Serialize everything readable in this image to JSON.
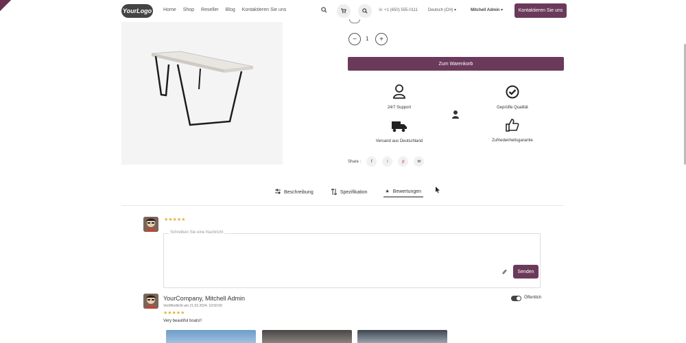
{
  "header": {
    "logo_text": "YourLogo",
    "nav": [
      "Home",
      "Shop",
      "Reseller",
      "Blog",
      "Kontaktieren Sie uns"
    ],
    "phone": "+1 (650) 555-0111",
    "language": "Deutsch (CH)",
    "user": "Mitchell Admin",
    "contact_button": "Kontaktieren Sie uns"
  },
  "product": {
    "quantity": "1",
    "add_to_cart": "Zum Warenkorb",
    "features": [
      {
        "label": "24/7 Support",
        "icon": "user-icon"
      },
      {
        "label": "Geprüfte Qualität",
        "icon": "check-circle-icon"
      },
      {
        "label": "Versand aus Deutschland",
        "icon": "truck-icon"
      },
      {
        "label": "Zufriedenheitsgarantie",
        "icon": "thumbs-up-icon"
      }
    ],
    "share_label": "Share :"
  },
  "tabs": [
    {
      "label": "Beschreibung",
      "icon": "sliders-icon"
    },
    {
      "label": "Spezifikation",
      "icon": "sort-icon"
    },
    {
      "label": "Bewertungen",
      "icon": "star-icon",
      "active": true
    }
  ],
  "review_form": {
    "rating_stars": "★★★★★",
    "placeholder": "Schreiben Sie eine Nachricht",
    "send_label": "Senden"
  },
  "review": {
    "author": "YourCompany, Mitchell Admin",
    "date": "Veröffentlicht am 21.02.2024, 10:50:00",
    "stars": "★★★★★",
    "text": "Very beautiful boats!!",
    "visibility_label": "Öffentlich"
  },
  "colors": {
    "accent": "#6b3a5b",
    "star": "#e3b23c"
  }
}
